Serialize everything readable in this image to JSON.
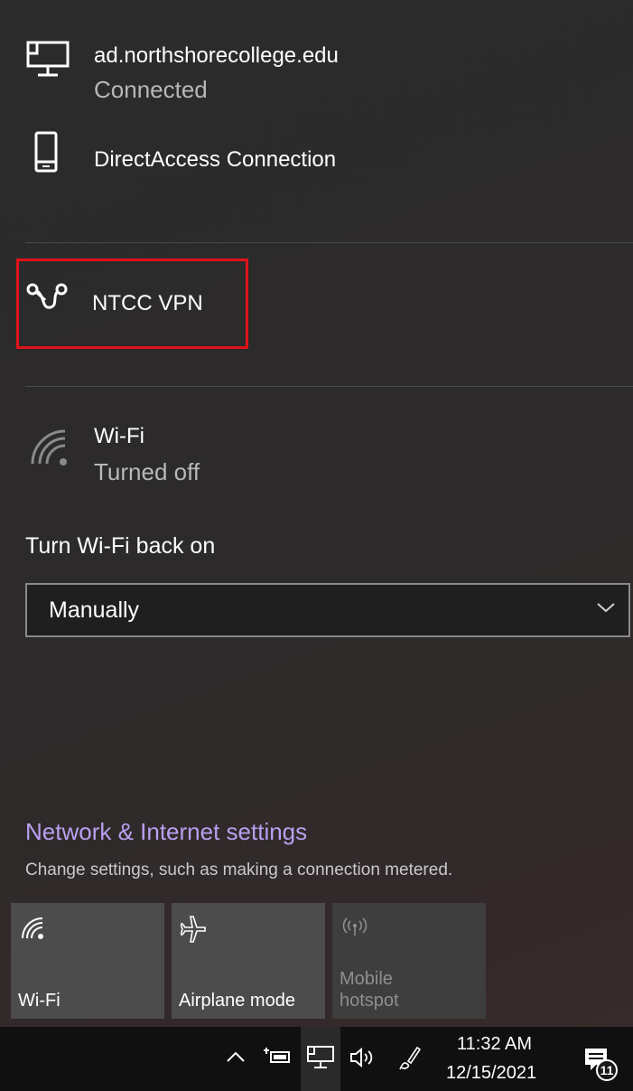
{
  "networks": {
    "ethernet": {
      "name": "ad.northshorecollege.edu",
      "status": "Connected",
      "icon": "ethernet-icon"
    },
    "directaccess": {
      "name": "DirectAccess Connection",
      "icon": "phone-device-icon"
    },
    "vpn": {
      "name": "NTCC VPN",
      "icon": "vpn-icon",
      "highlight_color": "#e0121a"
    },
    "wifi": {
      "name": "Wi-Fi",
      "status": "Turned off",
      "icon": "wifi-icon"
    }
  },
  "wifi_back_on": {
    "label": "Turn Wi-Fi back on",
    "selected": "Manually"
  },
  "settings": {
    "link": "Network & Internet settings",
    "description": "Change settings, such as making a connection metered.",
    "link_color": "#b9a0f0"
  },
  "quick_actions": [
    {
      "label": "Wi-Fi",
      "icon": "wifi-icon",
      "enabled": true
    },
    {
      "label": "Airplane mode",
      "icon": "airplane-icon",
      "enabled": true
    },
    {
      "label_line1": "Mobile",
      "label_line2": "hotspot",
      "icon": "mobile-hotspot-icon",
      "enabled": false
    }
  ],
  "taskbar": {
    "time": "11:32 AM",
    "date": "12/15/2021",
    "notification_count": "11"
  }
}
